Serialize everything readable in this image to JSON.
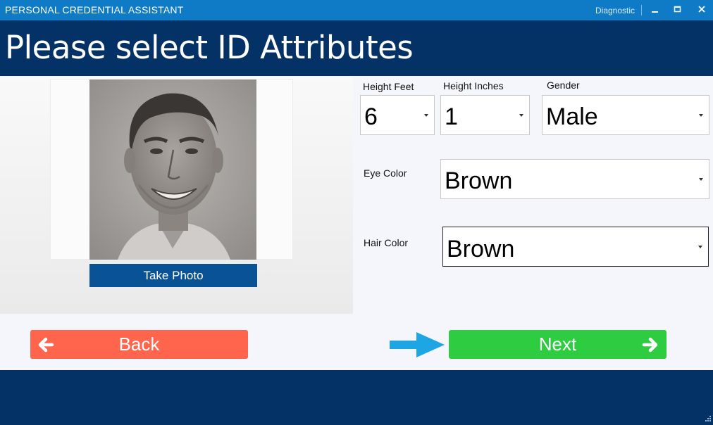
{
  "window": {
    "title": "PERSONAL CREDENTIAL ASSISTANT",
    "diagnostic_label": "Diagnostic"
  },
  "header": {
    "title": "Please select ID Attributes"
  },
  "photo": {
    "button_label": "Take Photo"
  },
  "form": {
    "height_feet": {
      "label": "Height Feet",
      "value": "6"
    },
    "height_inches": {
      "label": "Height Inches",
      "value": "1"
    },
    "gender": {
      "label": "Gender",
      "value": "Male"
    },
    "eye_color": {
      "label": "Eye Color",
      "value": "Brown"
    },
    "hair_color": {
      "label": "Hair Color",
      "value": "Brown"
    }
  },
  "nav": {
    "back_label": "Back",
    "next_label": "Next"
  },
  "icons": {
    "back": "arrow-left-icon",
    "next": "arrow-right-icon",
    "hint": "arrow-right-hint-icon"
  },
  "colors": {
    "titlebar": "#0f7bc6",
    "header": "#053266",
    "take_photo": "#0a5296",
    "back": "#ff644c",
    "next": "#2ecc40",
    "hint_arrow": "#1ea6e4"
  }
}
